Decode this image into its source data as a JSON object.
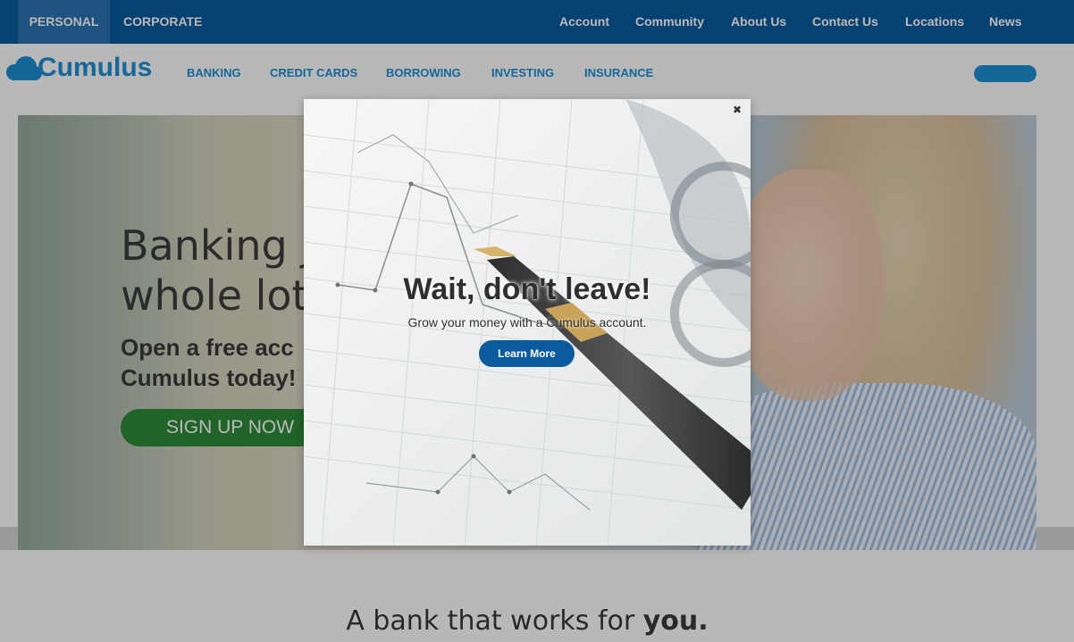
{
  "utility_bar": {
    "segments": [
      "PERSONAL",
      "CORPORATE"
    ],
    "active_segment": "PERSONAL",
    "links": [
      "Account",
      "Community",
      "About Us",
      "Contact Us",
      "Locations",
      "News"
    ]
  },
  "brand": {
    "name": "Cumulus"
  },
  "main_nav": [
    "BANKING",
    "CREDIT CARDS",
    "BORROWING",
    "INVESTING",
    "INSURANCE"
  ],
  "hero": {
    "title_line1": "Banking j",
    "title_line2": "whole lot",
    "subtitle_line1": "Open a free acc",
    "subtitle_line2": "Cumulus today!",
    "cta_label": "SIGN UP NOW"
  },
  "modal": {
    "close_symbol": "✖",
    "title": "Wait, don't leave!",
    "subtitle": "Grow your money with a Cumulus account.",
    "button_label": "Learn More"
  },
  "section": {
    "heading_text": "A bank that works for",
    "heading_emphasis": "you."
  },
  "colors": {
    "top_bar": "#0b5a9e",
    "brand_blue": "#1e8fd6",
    "cta_green": "#2e8b3a",
    "modal_button": "#0b5a9e"
  },
  "icons": {
    "logo": "cloud-icon",
    "close": "close-icon"
  }
}
